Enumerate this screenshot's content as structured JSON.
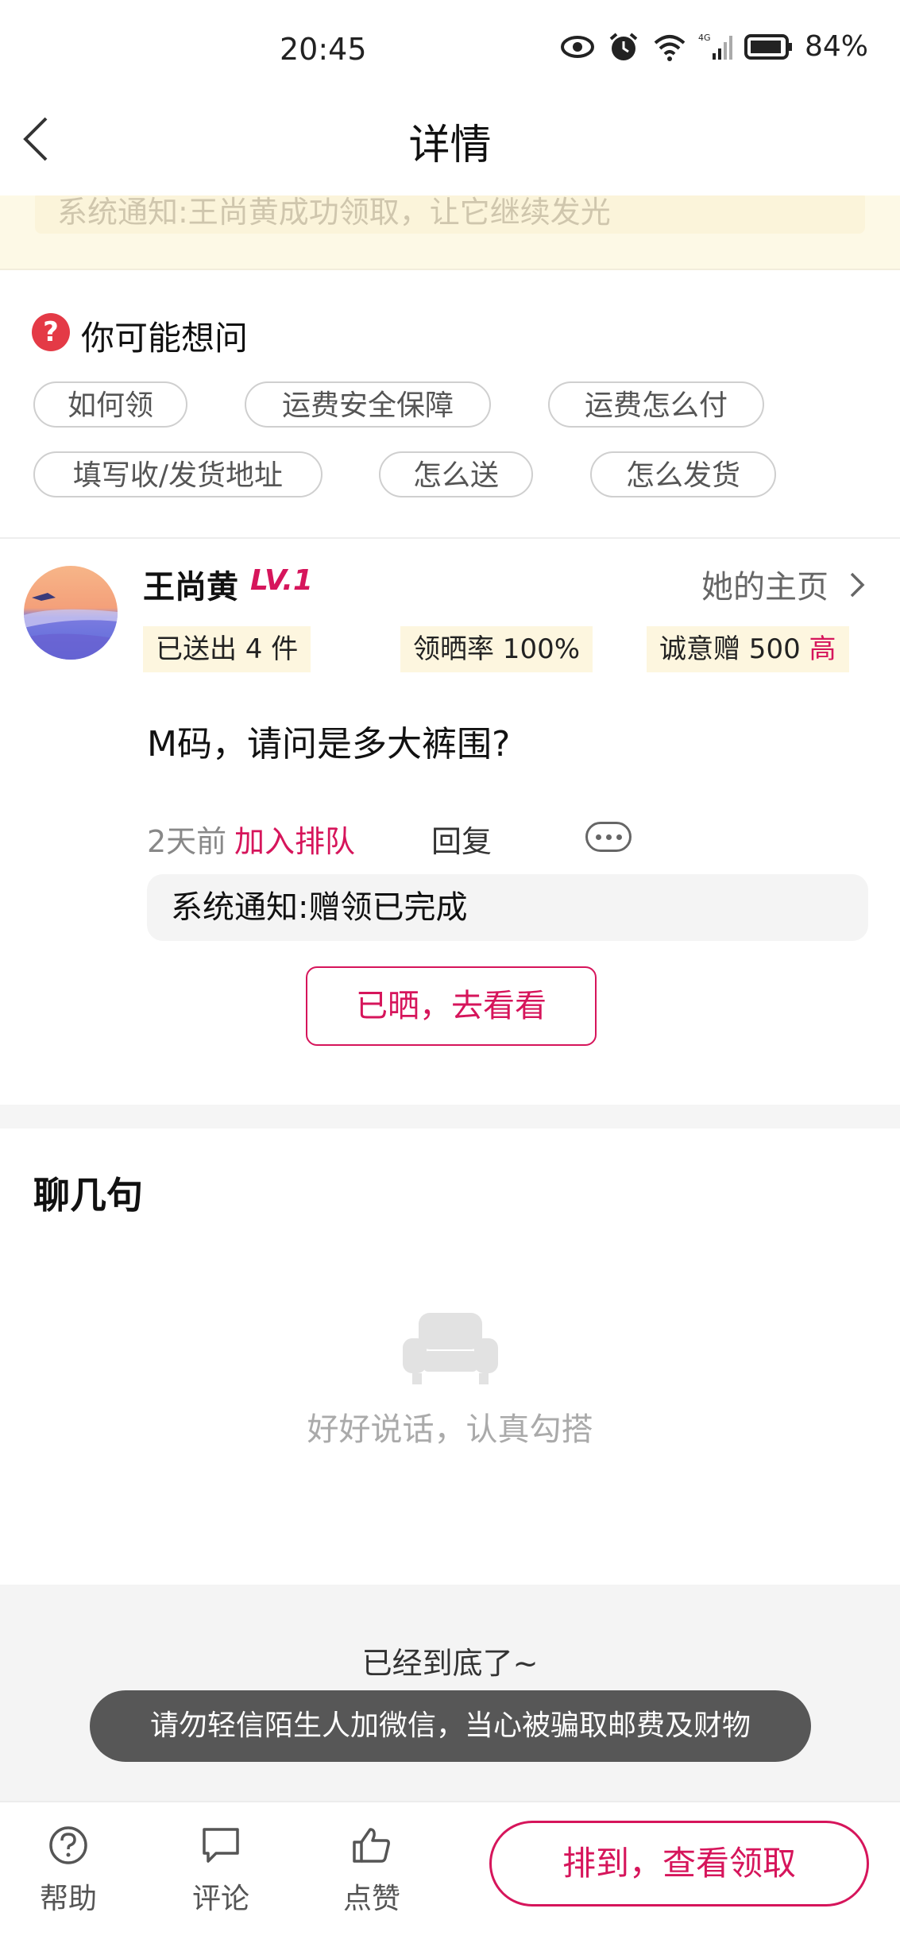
{
  "status_bar": {
    "time": "20:45",
    "battery": "84%",
    "network": "4G"
  },
  "header": {
    "title": "详情"
  },
  "banner": {
    "text": "系统通知:王尚黄成功领取，让它继续发光"
  },
  "faq": {
    "title": "你可能想问",
    "chips": [
      "如何领",
      "运费安全保障",
      "运费怎么付",
      "填写收/发货地址",
      "怎么送",
      "怎么发货"
    ]
  },
  "user": {
    "name": "王尚黄",
    "level": "LV.1",
    "homepage_link": "她的主页",
    "stats": {
      "sent": "已送出 4 件",
      "show_rate": "领晒率 100%",
      "sincerity": "诚意赠 500",
      "sincerity_level": "高"
    }
  },
  "post": {
    "question": "M码，请问是多大裤围?",
    "time": "2天前",
    "join_queue": "加入排队",
    "reply": "回复",
    "system_note": "系统通知:赠领已完成",
    "view_button": "已晒，去看看"
  },
  "chat": {
    "title": "聊几句",
    "empty_text": "好好说话，认真勾搭"
  },
  "footer": {
    "end_text": "已经到底了~",
    "toast": "请勿轻信陌生人加微信，当心被骗取邮费及财物"
  },
  "tabbar": {
    "help": "帮助",
    "comment": "评论",
    "like": "点赞",
    "cta": "排到，查看领取"
  },
  "colors": {
    "accent": "#d6155b",
    "banner_bg": "#fdf9e6",
    "badge_bg": "#fdf6df"
  }
}
